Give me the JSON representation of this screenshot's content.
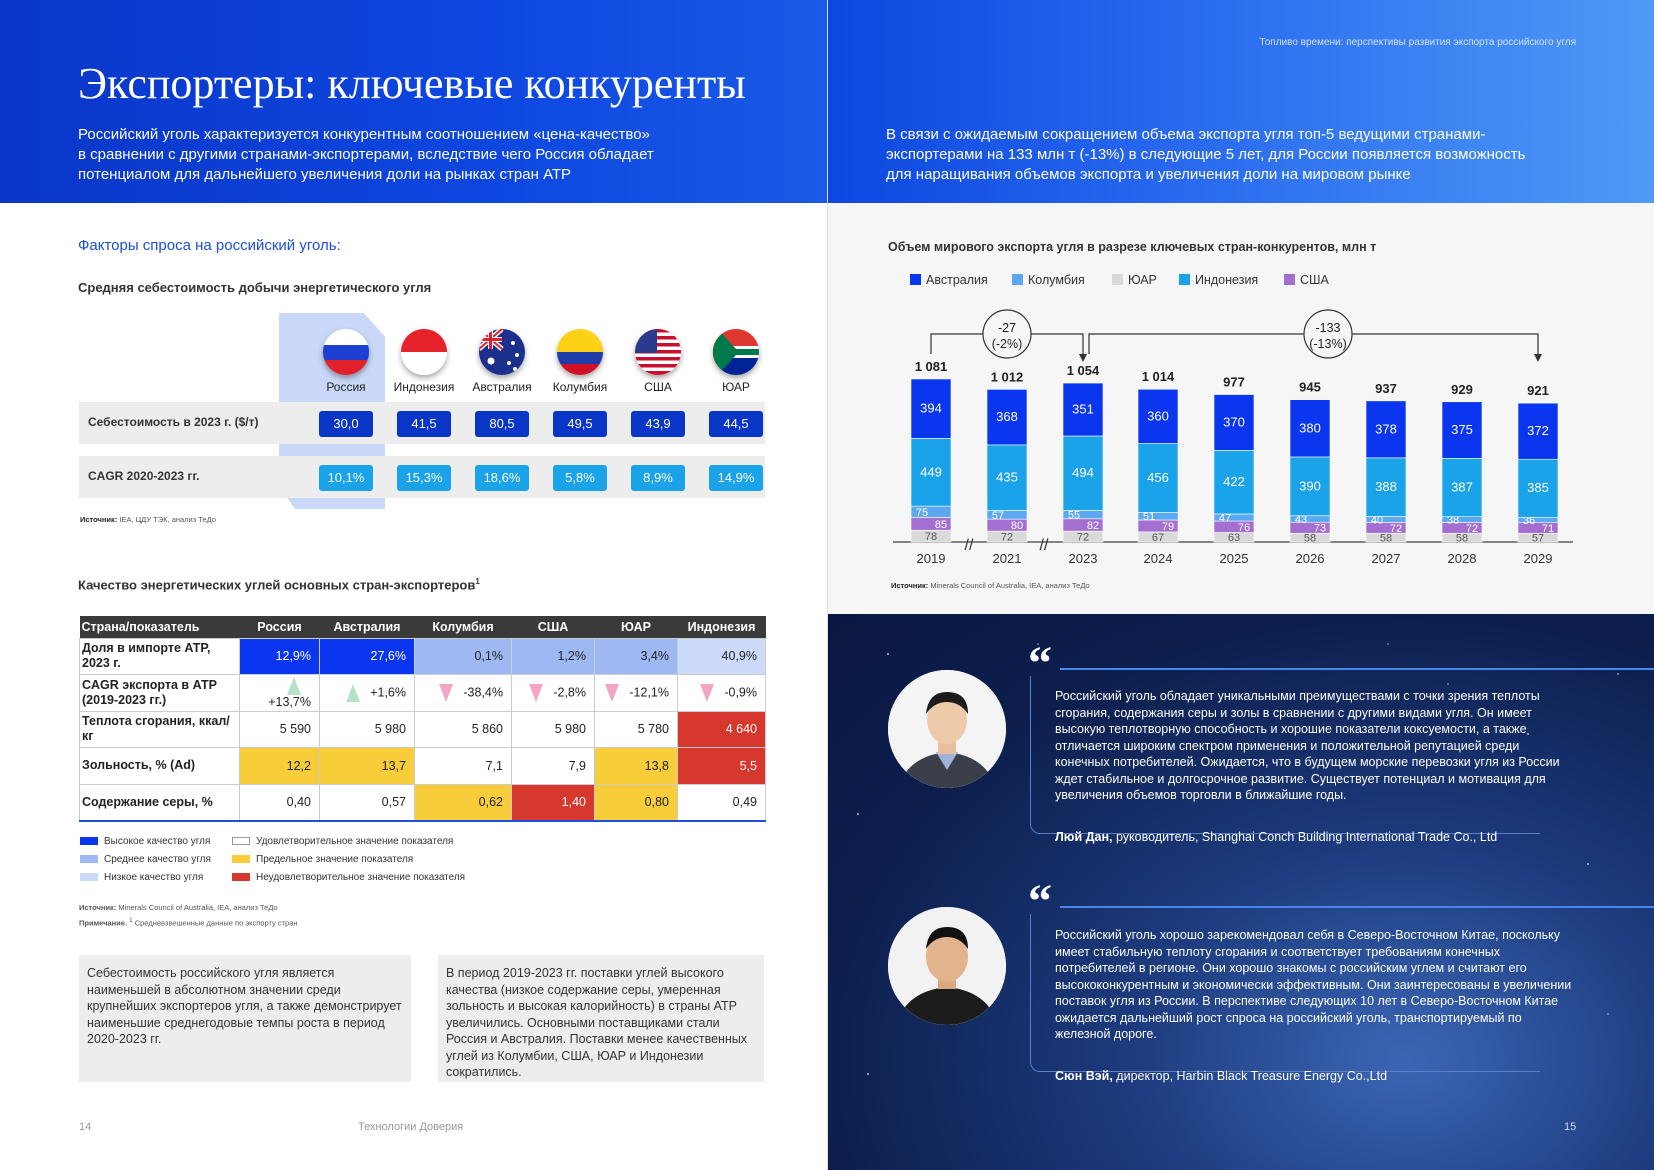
{
  "left": {
    "title": "Экспортеры: ключевые конкуренты",
    "intro": [
      "Российский уголь характеризуется конкурентным соотношением «цена-качество»",
      "в сравнении с другими странами-экспортерами, вследствие чего Россия обладает",
      "потенциалом для дальнейшего увеличения доли на рынках стран АТР"
    ],
    "section_title": "Факторы спроса на российский уголь:",
    "cost": {
      "title": "Средняя себестоимость добычи энергетического угля",
      "countries": [
        "Россия",
        "Индонезия",
        "Австралия",
        "Колумбия",
        "США",
        "ЮАР"
      ],
      "row1_label": "Себестоимость в 2023 г. ($/т)",
      "row1": [
        "30,0",
        "41,5",
        "80,5",
        "49,5",
        "43,9",
        "44,5"
      ],
      "row2_label": "CAGR 2020-2023 гг.",
      "row2": [
        "10,1%",
        "15,3%",
        "18,6%",
        "5,8%",
        "8,9%",
        "14,9%"
      ],
      "source_label": "Источник:",
      "source": "IEA, ЦДУ ТЭК, анализ ТеДо"
    },
    "quality": {
      "title": "Качество энергетических углей основных стран-экспортеров",
      "title_sup": "1",
      "headers": [
        "Страна/показатель",
        "Россия",
        "Австралия",
        "Колумбия",
        "США",
        "ЮАР",
        "Индонезия"
      ],
      "rows": [
        {
          "label": "Доля в импорте АТР, 2023 г.",
          "values": [
            "12,9%",
            "27,6%",
            "0,1%",
            "1,2%",
            "3,4%",
            "40,9%"
          ]
        },
        {
          "label": "CAGR экспорта в АТР (2019-2023 гг.)",
          "values": [
            "+13,7%",
            "+1,6%",
            "-38,4%",
            "-2,8%",
            "-12,1%",
            "-0,9%"
          ]
        },
        {
          "label": "Теплота сгорания, ккал/кг",
          "values": [
            "5 590",
            "5 980",
            "5 860",
            "5 980",
            "5 780",
            "4 640"
          ]
        },
        {
          "label": "Зольность, % (Ad)",
          "values": [
            "12,2",
            "13,7",
            "7,1",
            "7,9",
            "13,8",
            "5,5"
          ]
        },
        {
          "label": "Содержание серы, %",
          "values": [
            "0,40",
            "0,57",
            "0,62",
            "1,40",
            "0,80",
            "0,49"
          ]
        }
      ],
      "legend": [
        "Высокое качество угля",
        "Среднее качество угля",
        "Низкое качество угля",
        "Удовлетворительное значение показателя",
        "Предельное значение показателя",
        "Неудовлетворительное значение показателя"
      ],
      "source_label": "Источник:",
      "source": "Minerals Council of Australia, IEA, анализ ТеДо",
      "note_label": "Примечание.",
      "note_sup": "1",
      "note": "Средневзвешенные данные по экспорту стран"
    },
    "box1": "Себестоимость российского угля является наименьшей в абсолютном значении среди крупнейших экспортеров угля, а также демонстрирует наименьшие среднегодовые темпы роста в период 2020-2023 гг.",
    "box2": "В период 2019-2023 гг. поставки углей высокого качества (низкое содержание серы, умеренная зольность и высокая калорийность) в страны АТР увеличились. Основными поставщиками стали Россия и Австралия. Поставки менее качественных углей из Колумбии, США, ЮАР и Индонезии сократились.",
    "page_number": "14",
    "footer": "Технологии Доверия"
  },
  "right": {
    "running_head": "Топливо времени: перспективы развития экспорта российского угля",
    "intro": [
      "В связи с ожидаемым сокращением объема экспорта угля топ-5 ведущими странами-",
      "экспортерами на 133 млн т (-13%) в следующие 5 лет, для России появляется возможность",
      "для наращивания объемов экспорта и увеличения доли на мировом рынке"
    ],
    "chart_source_label": "Источник:",
    "chart_source": "Minerals Council of Australia, IEA, анализ ТеДо",
    "quotes": [
      {
        "text": "Российский уголь обладает уникальными преимуществами с точки зрения теплоты сгорания, содержания серы и золы в сравнении с другими видами угля. Он имеет высокую теплотворную способность и хорошие показатели коксуемости, а также отличается широким спектром применения и положительной репутацией среди конечных потребителей. Ожидается, что в будущем морские перевозки угля из России ждет стабильное и долгосрочное развитие. Существует потенциал и мотивация для увеличения объемов торговли в ближайшие годы.",
        "name": "Люй Дан,",
        "role": "руководитель, Shanghai Conch Building International Trade Co., Ltd"
      },
      {
        "text": "Российский уголь хорошо зарекомендовал себя в Северо-Восточном Китае, поскольку имеет стабильную теплоту сгорания и соответствует требованиям конечных потребителей в регионе. Они хорошо знакомы с российским углем и считают его высококонкурентным и экономически эффективным. Они заинтересованы в увеличении поставок угля из России. В перспективе следующих 10 лет в Северо-Восточном Китае ожидается дальнейший рост спроса на российский уголь, транспортируемый по железной дороге.",
        "name": "Сюн Вэй,",
        "role": "директор, Harbin Black Treasure Energy Co.,Ltd"
      }
    ],
    "page_number": "15"
  },
  "chart_data": {
    "type": "bar",
    "stacked": true,
    "title": "Объем мирового экспорта угля в разрезе ключевых стран-конкурентов, млн т",
    "categories": [
      "2019",
      "2021",
      "2023",
      "2024",
      "2025",
      "2026",
      "2027",
      "2028",
      "2029"
    ],
    "series": [
      {
        "name": "ЮАР",
        "color": "#d9d9d9",
        "values": [
          78,
          72,
          72,
          67,
          63,
          58,
          58,
          58,
          57
        ]
      },
      {
        "name": "США",
        "color": "#a46fd0",
        "values": [
          85,
          80,
          82,
          79,
          76,
          73,
          72,
          72,
          71
        ]
      },
      {
        "name": "Колумбия",
        "color": "#5aa9f0",
        "values": [
          75,
          57,
          55,
          51,
          47,
          43,
          40,
          38,
          36
        ]
      },
      {
        "name": "Индонезия",
        "color": "#1aa3e8",
        "values": [
          449,
          435,
          494,
          456,
          422,
          390,
          388,
          387,
          385
        ]
      },
      {
        "name": "Австралия",
        "color": "#0a36f0",
        "values": [
          394,
          368,
          351,
          360,
          370,
          380,
          378,
          375,
          372
        ]
      }
    ],
    "legend_order": [
      "Австралия",
      "Колумбия",
      "ЮАР",
      "Индонезия",
      "США"
    ],
    "totals": [
      "1 081",
      "1 012",
      "1 054",
      "1 014",
      "977",
      "945",
      "937",
      "929",
      "921"
    ],
    "annotations": [
      {
        "text": [
          "-27",
          "(-2%)"
        ]
      },
      {
        "text": [
          "-133",
          "(-13%)"
        ]
      }
    ],
    "axis_breaks": [
      "//",
      "//"
    ]
  }
}
